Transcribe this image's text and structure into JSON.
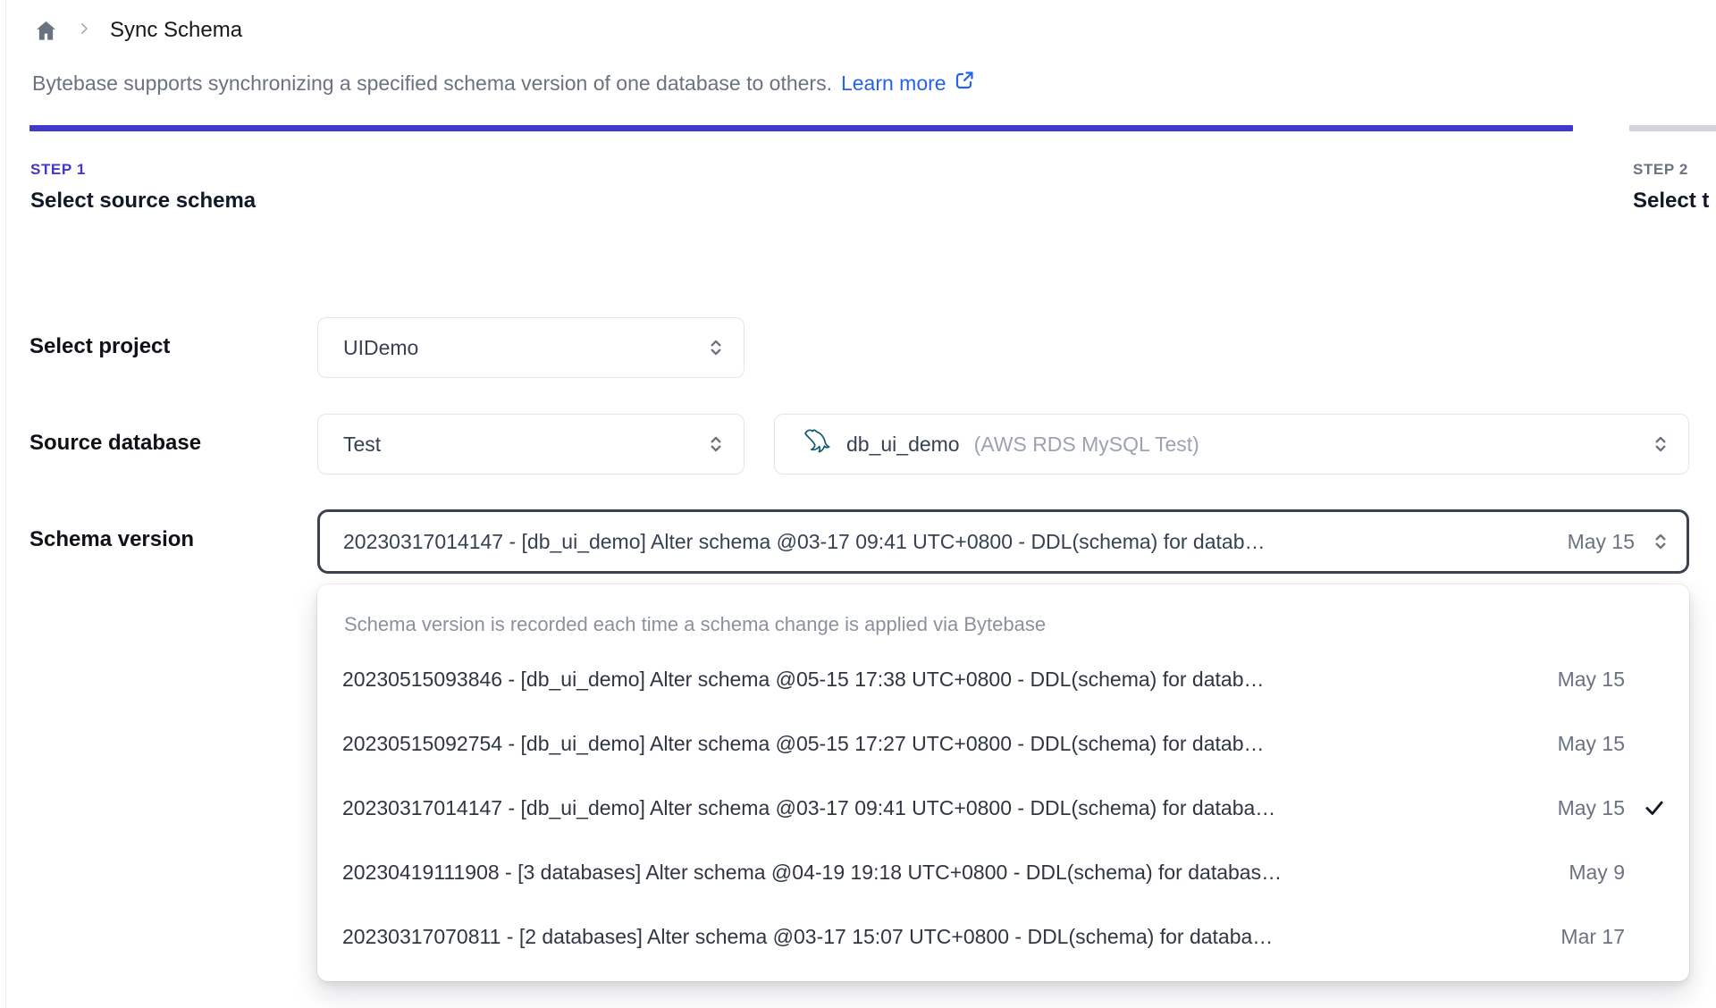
{
  "colors": {
    "accent_indigo": "#4338ca",
    "link_blue": "#2563eb",
    "inactive_step_gray": "#d1d5db",
    "focused_border": "#3b4350",
    "mysql_teal": "#0e5a70"
  },
  "breadcrumb": {
    "home_icon": "home",
    "separator_icon": "chevron-right",
    "title": "Sync Schema"
  },
  "intro": {
    "text": "Bytebase supports synchronizing a specified schema version of one database to others.",
    "link_label": "Learn more",
    "link_icon": "external-link"
  },
  "steps": {
    "step1": {
      "label": "STEP 1",
      "title": "Select source schema"
    },
    "step2": {
      "label": "STEP 2",
      "title": "Select t"
    }
  },
  "form": {
    "project": {
      "label": "Select project",
      "value": "UIDemo"
    },
    "source_database": {
      "label": "Source database",
      "environment_value": "Test",
      "database_icon": "mysql-dolphin",
      "database_value": "db_ui_demo",
      "database_detail": "(AWS RDS MySQL Test)"
    },
    "schema_version": {
      "label": "Schema version",
      "value": "20230317014147 - [db_ui_demo] Alter schema @03-17 09:41 UTC+0800 - DDL(schema) for datab…",
      "date": "May 15"
    }
  },
  "dropdown": {
    "hint": "Schema version is recorded each time a schema change is applied via Bytebase",
    "options": [
      {
        "text": "20230515093846 - [db_ui_demo] Alter schema @05-15 17:38 UTC+0800 - DDL(schema) for datab…",
        "date": "May 15",
        "selected": false
      },
      {
        "text": "20230515092754 - [db_ui_demo] Alter schema @05-15 17:27 UTC+0800 - DDL(schema) for datab…",
        "date": "May 15",
        "selected": false
      },
      {
        "text": "20230317014147 - [db_ui_demo] Alter schema @03-17 09:41 UTC+0800 - DDL(schema) for databa…",
        "date": "May 15",
        "selected": true
      },
      {
        "text": "20230419111908 - [3 databases] Alter schema @04-19 19:18 UTC+0800 - DDL(schema) for databas…",
        "date": "May 9",
        "selected": false
      },
      {
        "text": "20230317070811 - [2 databases] Alter schema @03-17 15:07 UTC+0800 - DDL(schema) for databa…",
        "date": "Mar 17",
        "selected": false
      }
    ]
  }
}
